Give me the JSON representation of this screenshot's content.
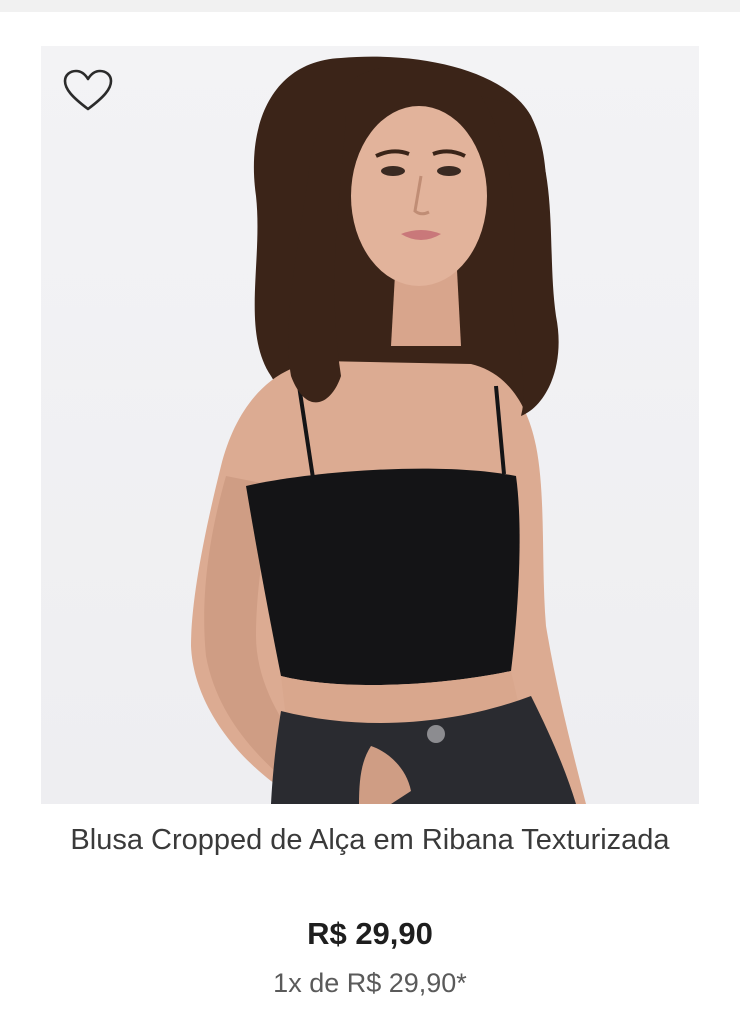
{
  "product": {
    "title": "Blusa Cropped de Alça em Ribana Texturizada",
    "price": "R$ 29,90",
    "installments": "1x de R$ 29,90*",
    "wishlist_icon": "heart-outline-icon",
    "image_alt": "Modelo vestindo blusa cropped preta de alça com calça jeans escura"
  },
  "colors": {
    "price_text": "#1e1e1e",
    "title_text": "#3a3a3a",
    "installments_text": "#5a5a5a",
    "image_background": "#f0f0f2"
  }
}
